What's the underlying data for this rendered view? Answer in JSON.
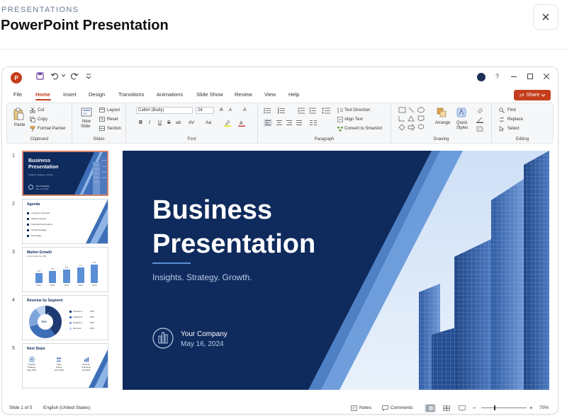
{
  "header": {
    "kicker": "PRESENTATIONS",
    "title": "PowerPoint Presentation",
    "close_icon": "close-icon"
  },
  "app": {
    "logo": "P",
    "title_icons": [
      "save-icon",
      "undo-icon",
      "redo-icon",
      "customize-icon"
    ],
    "window_controls": [
      "account-icon",
      "help-icon",
      "minimize-icon",
      "maximize-icon",
      "close-icon"
    ],
    "help_label": "?",
    "menu": [
      "File",
      "Home",
      "Insert",
      "Design",
      "Transitions",
      "Animations",
      "Slide Show",
      "Review",
      "View",
      "Help"
    ],
    "active_menu": "Home",
    "share_label": "Share",
    "accent": "#c43e1c"
  },
  "ribbon": {
    "clipboard": {
      "paste": "Paste",
      "cut": "Cut",
      "copy": "Copy",
      "format_painter": "Format Painter",
      "label": "Clipboard"
    },
    "slides": {
      "new_slide": "New",
      "new_slide2": "Slide",
      "layout": "Layout",
      "reset": "Reset",
      "section": "Section",
      "label": "Slides"
    },
    "font": {
      "family": "Calibri (Body)",
      "size": "24",
      "bold": "B",
      "italic": "I",
      "underline": "U",
      "strike": "S",
      "shadow": "ab",
      "spacing": "AV",
      "case": "Aa",
      "grow": "A",
      "shrink": "A",
      "clear": "A",
      "label": "Font"
    },
    "paragraph": {
      "text_direction": "Text Direction",
      "align_text": "Align Text",
      "smartart": "Convert to SmartArt",
      "label": "Paragraph"
    },
    "drawing": {
      "arrange": "Arrange",
      "quick_styles": "Quick",
      "quick_styles2": "Styles",
      "label": "Drawing"
    },
    "editing": {
      "find": "Find",
      "replace": "Replace",
      "select": "Select",
      "label": "Editing"
    }
  },
  "slides": [
    {
      "num": "1",
      "title": "Business Presentation",
      "sub": "Insights. Strategy. Growth.",
      "company": "Your Company",
      "date": "May 16, 2024"
    },
    {
      "num": "2",
      "title": "Agenda",
      "items": [
        "Company Overview",
        "Market Analysis",
        "Financial Performance",
        "Growth Strategy",
        "Next Steps"
      ]
    },
    {
      "num": "3",
      "title": "Market Growth",
      "sub": "Annual Market Size ($B)",
      "years": [
        "2020",
        "2021",
        "2022",
        "2023",
        "2024"
      ],
      "values": [
        "4.5",
        "5.4",
        "6.2",
        "7.1",
        "8.3"
      ]
    },
    {
      "num": "4",
      "title": "Revenue by Segment",
      "center": "70%",
      "segments": [
        {
          "name": "Product A",
          "pct": "40%"
        },
        {
          "name": "Product B",
          "pct": "30%"
        },
        {
          "name": "Product C",
          "pct": "20%"
        },
        {
          "name": "Services",
          "pct": "10%"
        }
      ]
    },
    {
      "num": "5",
      "title": "Next Steps",
      "steps": [
        [
          "Finalize",
          "Strategy",
          "May 2024"
        ],
        [
          "Align",
          "Teams",
          "June 2024"
        ],
        [
          "Execute",
          "& Review",
          "Q3 2024"
        ]
      ]
    }
  ],
  "main_slide": {
    "title_line1": "Business",
    "title_line2": "Presentation",
    "subtitle": "Insights. Strategy. Growth.",
    "company": "Your Company",
    "date": "May 16, 2024",
    "bg": "#0f2a5c",
    "accent": "#5b8fd6"
  },
  "status": {
    "slide": "Slide 1 of 5",
    "language": "English (United States)",
    "notes": "Notes",
    "comments": "Comments",
    "zoom": "70%",
    "minus": "–",
    "plus": "+"
  }
}
